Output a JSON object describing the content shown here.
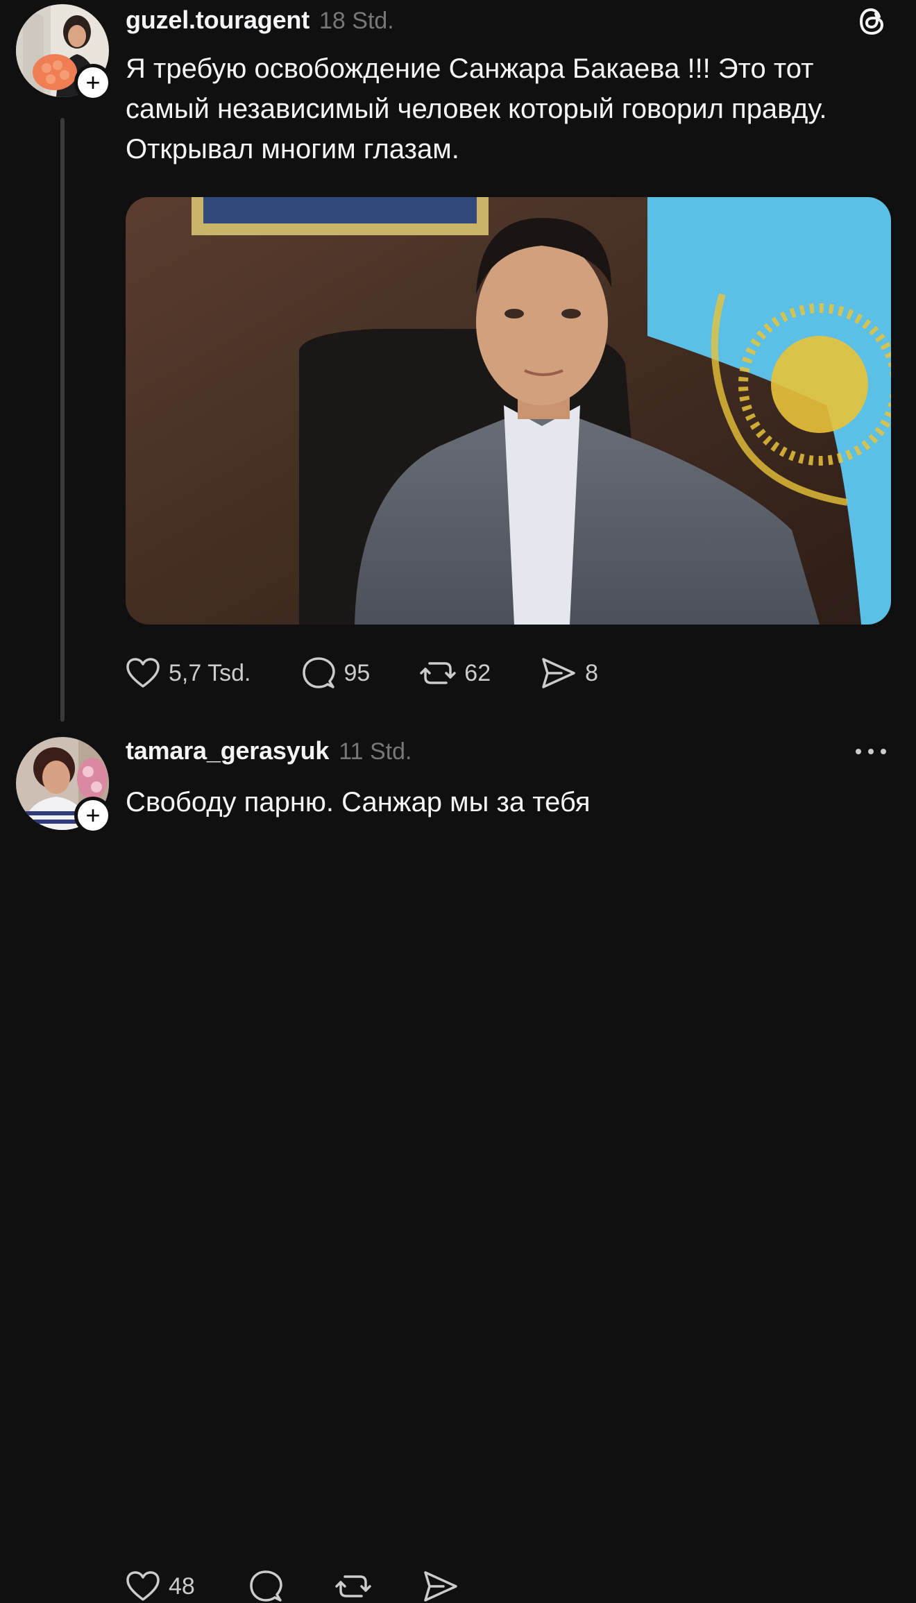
{
  "posts": [
    {
      "username": "guzel.touragent",
      "time": "18 Std.",
      "text": "Я требую освобождение Санжара Бакаева !!! Это тот самый независимый человек который говорил правду. Открывал многим глазам.",
      "likes": "5,7 Tsd.",
      "comments": "95",
      "reposts": "62",
      "shares": "8"
    },
    {
      "username": "tamara_gerasyuk",
      "time": "11 Std.",
      "text": "Свободу парню. Санжар мы за тебя",
      "likes": "48"
    }
  ],
  "follow_symbol": "+",
  "icons": {
    "like": "heart-icon",
    "comment": "comment-bubble-icon",
    "repost": "repost-icon",
    "share": "send-icon",
    "app": "threads-logo-icon",
    "more": "more-dots-icon"
  },
  "colors": {
    "background": "#101010",
    "text": "#f3f5f7",
    "muted": "#777777",
    "thread_line": "#3a3a3a",
    "flag_blue": "#5bbfe6",
    "flag_gold": "#e8c33a"
  }
}
